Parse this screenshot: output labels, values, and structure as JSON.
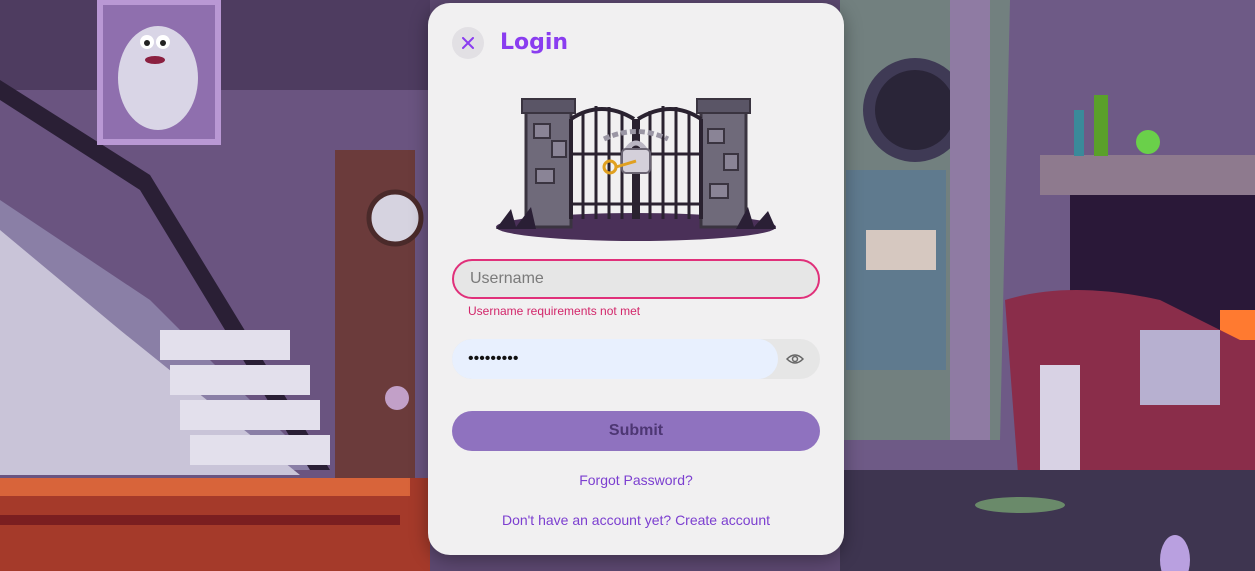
{
  "login": {
    "title": "Login",
    "close_icon": "close-icon",
    "username_placeholder": "Username",
    "username_value": "",
    "username_error": "Username requirements not met",
    "password_value": "•••••••••",
    "password_toggle_icon": "eye-icon",
    "submit_label": "Submit",
    "forgot_password": "Forgot Password?",
    "create_account": "Don't have an account yet? Create account"
  },
  "colors": {
    "accent": "#8a3df0",
    "error": "#e0307a",
    "submit_bg": "#8f72bf",
    "link": "#7c3fd0"
  }
}
